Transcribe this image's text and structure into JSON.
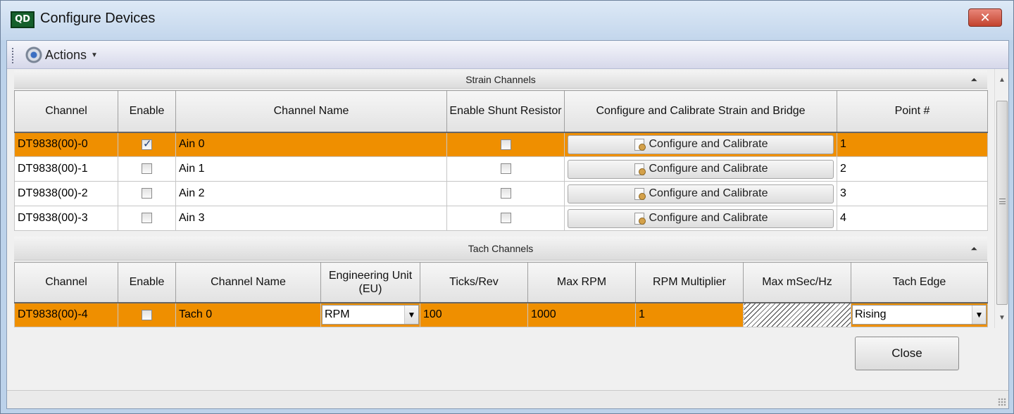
{
  "window": {
    "app_icon_text": "QD",
    "title": "Configure Devices",
    "close_glyph": "✕"
  },
  "toolbar": {
    "actions_label": "Actions"
  },
  "strain_group": {
    "title": "Strain Channels",
    "columns": [
      "Channel",
      "Enable",
      "Channel Name",
      "Enable Shunt Resistor",
      "Configure and Calibrate Strain and Bridge",
      "Point #"
    ],
    "rows": [
      {
        "channel": "DT9838(00)-0",
        "enabled": true,
        "name": "Ain 0",
        "shunt": false,
        "button": "Configure and Calibrate",
        "point": "1",
        "selected": true
      },
      {
        "channel": "DT9838(00)-1",
        "enabled": false,
        "name": "Ain 1",
        "shunt": false,
        "button": "Configure and Calibrate",
        "point": "2",
        "selected": false
      },
      {
        "channel": "DT9838(00)-2",
        "enabled": false,
        "name": "Ain 2",
        "shunt": false,
        "button": "Configure and Calibrate",
        "point": "3",
        "selected": false
      },
      {
        "channel": "DT9838(00)-3",
        "enabled": false,
        "name": "Ain 3",
        "shunt": false,
        "button": "Configure and Calibrate",
        "point": "4",
        "selected": false
      }
    ]
  },
  "tach_group": {
    "title": "Tach Channels",
    "columns": [
      "Channel",
      "Enable",
      "Channel Name",
      "Engineering Unit (EU)",
      "Ticks/Rev",
      "Max RPM",
      "RPM Multiplier",
      "Max mSec/Hz",
      "Tach Edge"
    ],
    "rows": [
      {
        "channel": "DT9838(00)-4",
        "enabled": false,
        "name": "Tach 0",
        "unit": "RPM",
        "ticks": "100",
        "max_rpm": "1000",
        "multiplier": "1",
        "tach_edge": "Rising",
        "selected": true
      }
    ]
  },
  "close_label": "Close",
  "colors": {
    "selected_row": "#ef8f00",
    "title_bar": "#c3d6ec",
    "close_button": "#c3432e"
  }
}
